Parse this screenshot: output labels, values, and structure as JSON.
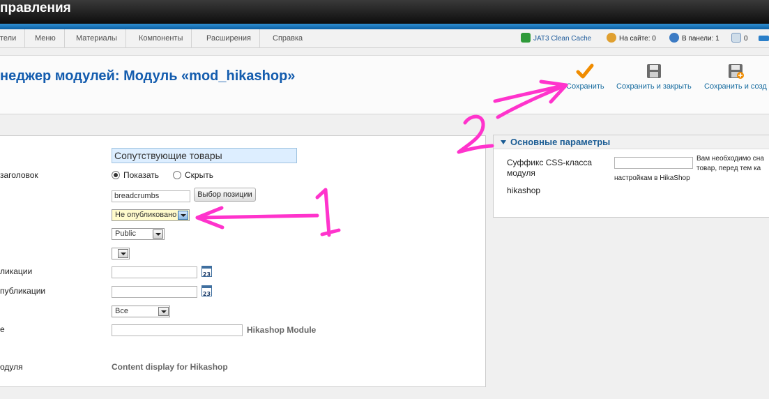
{
  "header": {
    "title": "правления"
  },
  "menu": {
    "items": [
      "тели",
      "Меню",
      "Материалы",
      "Компоненты",
      "Расширения",
      "Справка"
    ]
  },
  "status": {
    "cache": "JAT3 Clean Cache",
    "onsite": "На сайте: 0",
    "inpanel": "В панели: 1",
    "messages": "0"
  },
  "toolbar": {
    "page_title": "неджер модулей: Модуль «mod_hikashop»",
    "save": "Сохранить",
    "save_close": "Сохранить и закрыть",
    "save_new": "Сохранить и созд"
  },
  "form": {
    "title_value": "Сопутствующие товары",
    "show_title_label": "заголовок",
    "show_option": "Показать",
    "hide_option": "Скрыть",
    "position_value": "breadcrumbs",
    "position_button": "Выбор позиции",
    "status_value": "Не опубликовано",
    "access_value": "Public",
    "start_publish_label": "ликации",
    "finish_publish_label": " публикации",
    "language_value": "Все",
    "note_label": "е",
    "note_suffix": "Hikashop Module",
    "module_label": "одуля",
    "module_desc": "Content display for Hikashop"
  },
  "params": {
    "header": "Основные параметры",
    "css_label": "Суффикс CSS-класса модуля",
    "hikashop_label": "hikashop",
    "notice_line1": "Вам необходимо сна",
    "notice_line2": "товар, перед тем ка",
    "notice_line3": "настройкам в HikaShop"
  },
  "annotations": {
    "label_1": "1",
    "label_2": "2",
    "color": "#ff33cc"
  }
}
